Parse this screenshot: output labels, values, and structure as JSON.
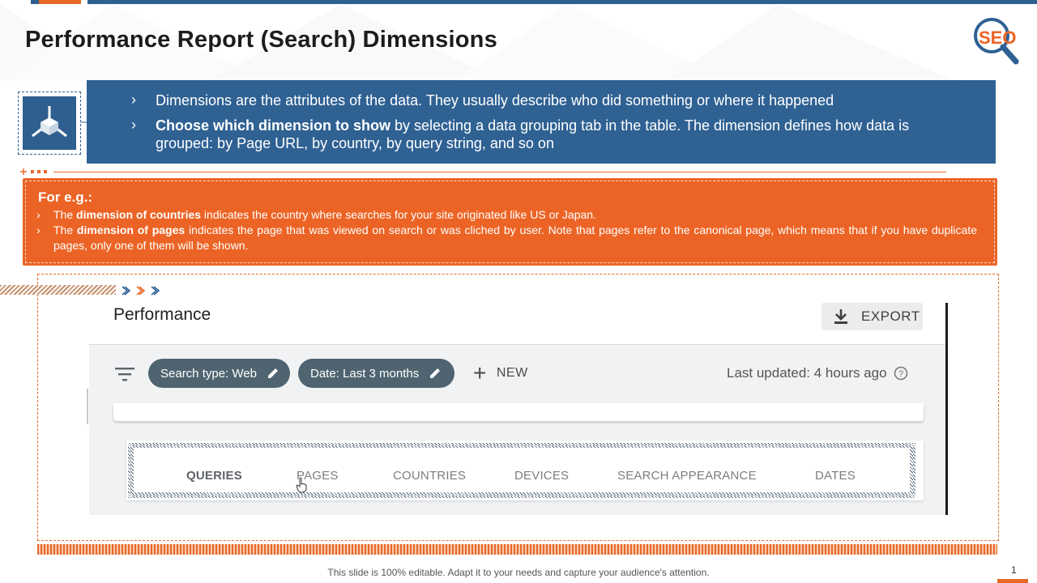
{
  "slide": {
    "title": "Performance Report (Search) Dimensions",
    "logo_text": "SEO",
    "footer_note": "This slide is 100% editable. Adapt it to your needs and capture your audience's attention.",
    "page_number": "1"
  },
  "info_panel": {
    "bullet_glyph": "›",
    "point1": "Dimensions are the attributes of the data. They usually describe who did something or where it happened",
    "point2_bold": "Choose which dimension to show",
    "point2_rest": " by selecting a data grouping tab in the table. The dimension defines how data is grouped: by Page URL, by country, by query string, and so on"
  },
  "example_panel": {
    "title": "For e.g.:",
    "bullet_glyph": "›",
    "item1_pre": "The ",
    "item1_bold": "dimension of countries",
    "item1_post": " indicates the country where searches for your site originated like US or Japan.",
    "item2_pre": "The ",
    "item2_bold": "dimension of pages",
    "item2_post": " indicates the page that was viewed on search or was cliched by user. Note that pages refer to the canonical page, which means that if you have duplicate pages, only one of them will be shown."
  },
  "search_console": {
    "title": "Performance",
    "export_label": "EXPORT",
    "filters": [
      {
        "label": "Search type: Web"
      },
      {
        "label": "Date: Last 3 months"
      }
    ],
    "new_label": "NEW",
    "last_updated": "Last updated: 4 hours ago",
    "tabs": [
      "QUERIES",
      "PAGES",
      "COUNTRIES",
      "DEVICES",
      "SEARCH APPEARANCE",
      "DATES"
    ],
    "active_tab": "QUERIES"
  },
  "colors": {
    "accent_orange": "#ec6425",
    "panel_blue": "#2f6193",
    "chip_slate": "#4f6470"
  },
  "icons": {
    "logo": "seo-magnifier-icon",
    "panel_icon": "cube-network-icon",
    "export": "download-icon",
    "filter": "filter-lines-icon",
    "chip_edit": "pencil-icon",
    "help": "question-circle-icon",
    "cursor": "hand-pointer-icon"
  }
}
